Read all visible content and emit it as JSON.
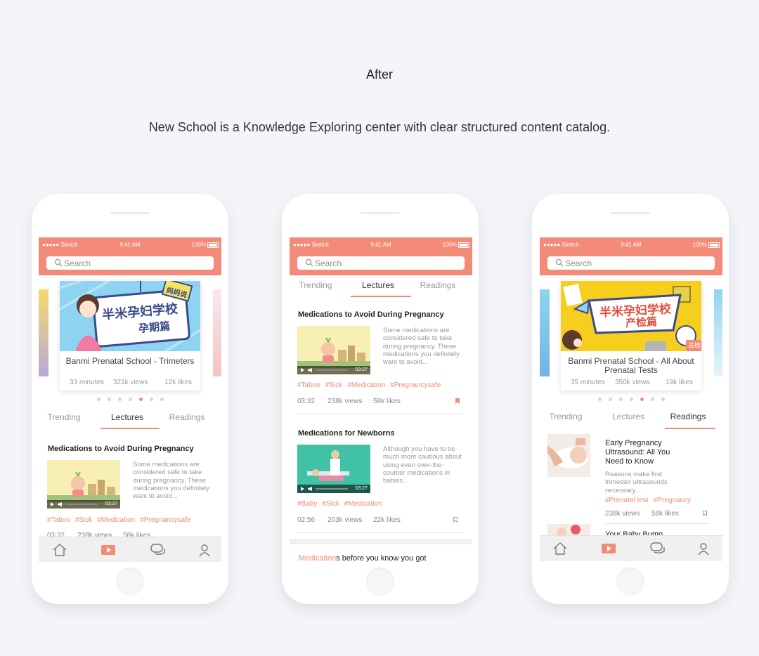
{
  "page": {
    "heading": "After",
    "subtitle": "New School is a Knowledge Exploring center with clear structured content catalog."
  },
  "colors": {
    "accent": "#f38b78",
    "background": "#f4f5f9"
  },
  "status_bar": {
    "carrier": "●●●●● Sketch",
    "time": "9:41 AM",
    "battery": "100%"
  },
  "search": {
    "placeholder": "Search"
  },
  "tabs": [
    "Trending",
    "Lectures",
    "Readings"
  ],
  "tabbar_icons": [
    "home-icon",
    "video-icon",
    "chat-icon",
    "profile-icon"
  ],
  "phone1": {
    "active_tab": "Lectures",
    "featured": {
      "title": "Banmi Prenatal School - Trimeters",
      "duration": "33 minutes",
      "views": "321k views",
      "likes": "12k likes",
      "image_text": "半米孕妇学校",
      "image_text2": "孕期篇",
      "badge": "妈妈说"
    },
    "carousel_dots": 7,
    "carousel_active_dot": 4,
    "lecture": {
      "title": "Medications to Avoid During Pregnancy",
      "description": "Some medications are considered safe to take during pregnancy. These medications you definitely want to avoid...",
      "duration": "03:27",
      "tags": [
        "#Taboo",
        "#Sick",
        "#Medication",
        "#Pregnancysafe"
      ],
      "time": "03:32",
      "views": "238k views",
      "likes": "58k likes"
    }
  },
  "phone2": {
    "active_tab": "Lectures",
    "lectures": [
      {
        "title": "Medications to Avoid During Pregnancy",
        "description": "Some medications are considered safe to take during pregnancy. These medications you definitely want to avoid...",
        "duration": "03:27",
        "tags": [
          "#Taboo",
          "#Sick",
          "#Medication",
          "#Pregnancysafe"
        ],
        "time": "03:32",
        "views": "238k views",
        "likes": "58k likes",
        "bookmarked": true
      },
      {
        "title": "Medications for Newborns",
        "description": "Although you have to be much more cautious about using even over-the-counter medications in babies...",
        "duration": "03:27",
        "tags": [
          "#Baby",
          "#Sick",
          "#Medication"
        ],
        "time": "02:56",
        "views": "203k views",
        "likes": "22k likes",
        "bookmarked": false
      }
    ],
    "peek_text_accent": "Medication",
    "peek_text_rest": "s before you know you got"
  },
  "phone3": {
    "active_tab": "Readings",
    "featured": {
      "title": "Banmi Prenatal School - All About Prenatal Tests",
      "duration": "35 minutes",
      "views": "350k views",
      "likes": "19k likes",
      "image_text": "半米孕妇学校",
      "image_text2": "产检篇",
      "badge": "去检"
    },
    "carousel_dots": 7,
    "carousel_active_dot": 4,
    "reading": {
      "title": "Early Pregnancy Ultrasound: All You Need to Know",
      "description": "Reasons make first trimester ultrasounds necessary....",
      "tags": [
        "#Prenatal test",
        "#Pregnancy"
      ],
      "views": "238k views",
      "likes": "58k likes"
    },
    "next_reading_title": "Your Baby Bump"
  }
}
